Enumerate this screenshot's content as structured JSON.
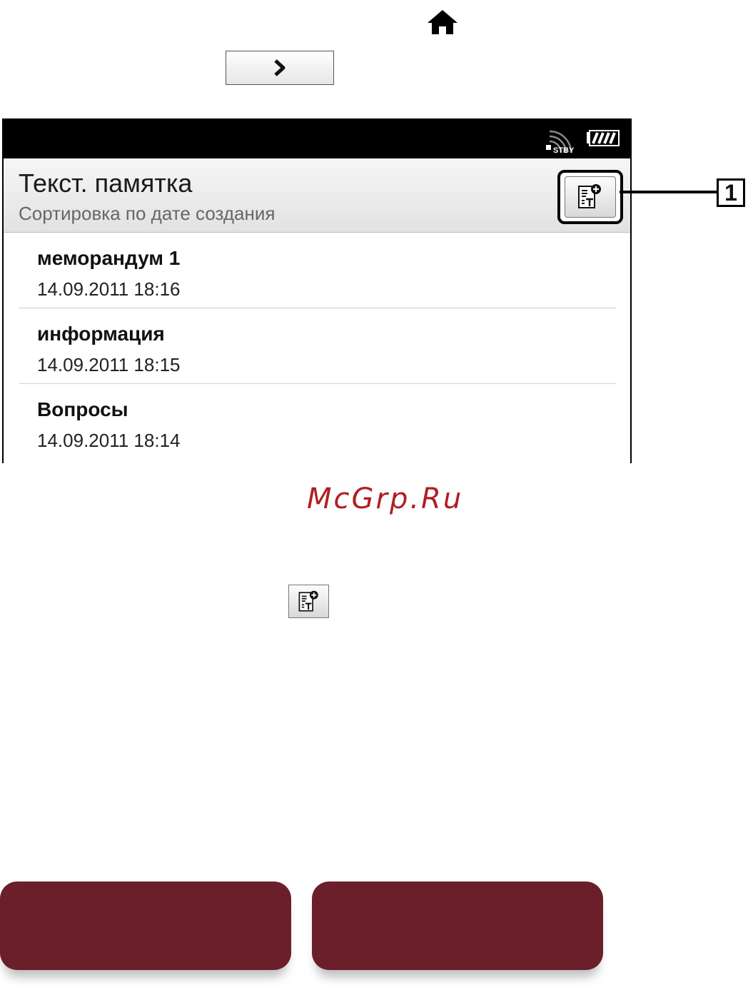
{
  "instructions": {
    "home_icon": "home-icon",
    "next_icon": "chevron-right-icon"
  },
  "screen": {
    "status_bar": {
      "wireless_status": "STBY",
      "battery_icon": "battery-icon"
    },
    "header": {
      "title": "Текст. памятка",
      "subtitle": "Сортировка по дате создания",
      "new_memo_icon": "new-text-memo-icon"
    },
    "memos": [
      {
        "title": "меморандум 1",
        "date": "14.09.2011 18:16"
      },
      {
        "title": "информация",
        "date": "14.09.2011 18:15"
      },
      {
        "title": "Вопросы",
        "date": "14.09.2011 18:14"
      }
    ]
  },
  "callout": {
    "label": "1"
  },
  "watermark": "McGrp.Ru",
  "colors": {
    "status_bar": "#000000",
    "bottom_tab": "#6b1f2b",
    "watermark": "#b01e23"
  }
}
